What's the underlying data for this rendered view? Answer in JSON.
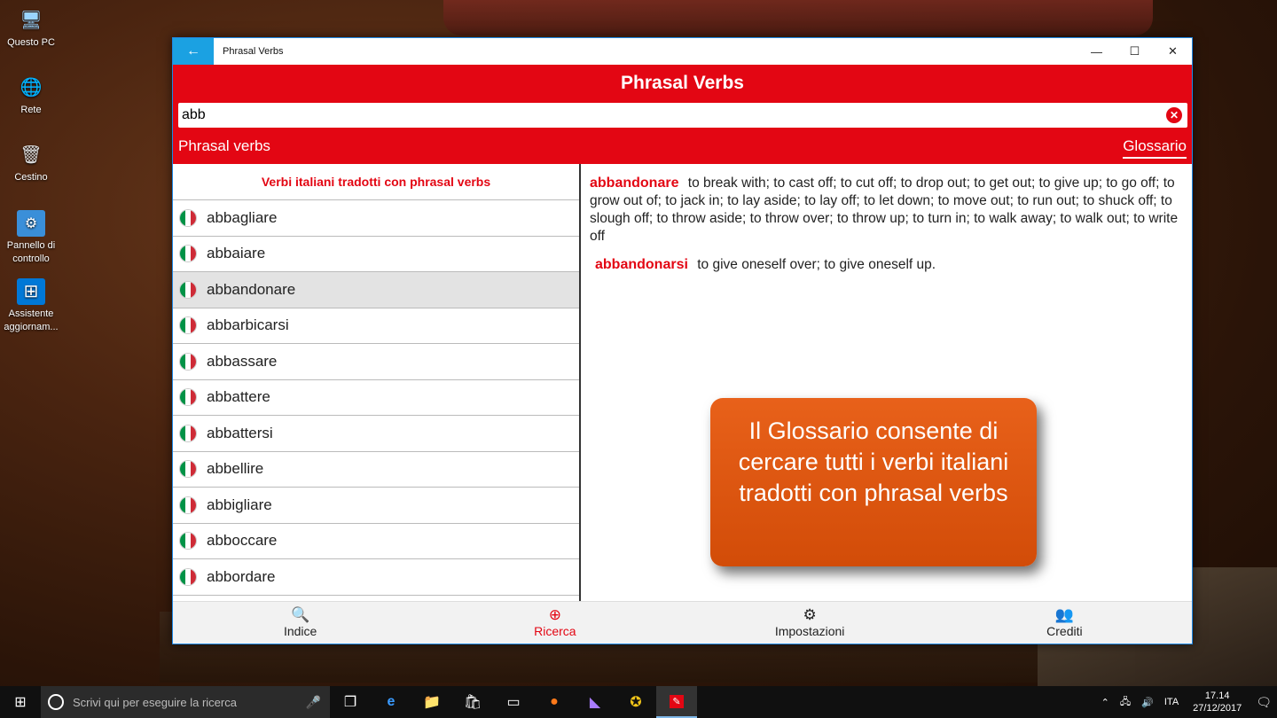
{
  "desktop": {
    "icons": [
      {
        "label": "Questo PC",
        "icon": "computer-icon",
        "glyph": "🖥"
      },
      {
        "label": "Rete",
        "icon": "network-icon",
        "glyph": "🌐"
      },
      {
        "label": "Cestino",
        "icon": "recycle-bin-icon",
        "glyph": "🗑"
      },
      {
        "label": "Pannello di controllo",
        "icon": "control-panel-icon",
        "glyph": "⚙"
      },
      {
        "label": "Assistente aggiornam...",
        "icon": "windows-update-icon",
        "glyph": "⊞"
      }
    ]
  },
  "window": {
    "title": "Phrasal Verbs",
    "back_icon": "←",
    "minimize_icon": "—",
    "maximize_icon": "☐",
    "close_icon": "✕"
  },
  "header": {
    "app_title": "Phrasal Verbs",
    "search_value": "abb",
    "clear_icon": "✕",
    "tab_left": "Phrasal verbs",
    "tab_right": "Glossario"
  },
  "list": {
    "header": "Verbi italiani tradotti con phrasal verbs",
    "items": [
      "abbagliare",
      "abbaiare",
      "abbandonare",
      "abbarbicarsi",
      "abbassare",
      "abbattere",
      "abbattersi",
      "abbellire",
      "abbigliare",
      "abboccare",
      "abbordare"
    ],
    "selected": "abbandonare"
  },
  "detail": {
    "entries": [
      {
        "term": "abbandonare",
        "definition": "to break with; to cast off; to cut off; to drop out; to get out; to give up; to go off; to grow out of; to jack in; to lay aside; to lay off; to let down; to move out; to run out; to shuck off; to slough off; to throw aside; to throw over; to throw up; to turn in; to walk away; to walk out; to write off"
      },
      {
        "term": "abbandonarsi",
        "definition": "to give oneself over; to give oneself up."
      }
    ]
  },
  "callout": {
    "text": "Il Glossario consente di cercare tutti i  verbi italiani tradotti con phrasal verbs"
  },
  "bottom_nav": [
    {
      "label": "Indice",
      "icon": "search-icon",
      "glyph": "🔍"
    },
    {
      "label": "Ricerca",
      "icon": "zoom-in-icon",
      "glyph": "⊕"
    },
    {
      "label": "Impostazioni",
      "icon": "gear-icon",
      "glyph": "⚙"
    },
    {
      "label": "Crediti",
      "icon": "people-icon",
      "glyph": "👥"
    }
  ],
  "taskbar": {
    "search_placeholder": "Scrivi qui per eseguire la ricerca",
    "language": "ITA",
    "time": "17.14",
    "date": "27/12/2017"
  },
  "colors": {
    "brand_red": "#e30613",
    "callout_orange": "#e05a12",
    "accent_blue": "#1ba1e2"
  }
}
